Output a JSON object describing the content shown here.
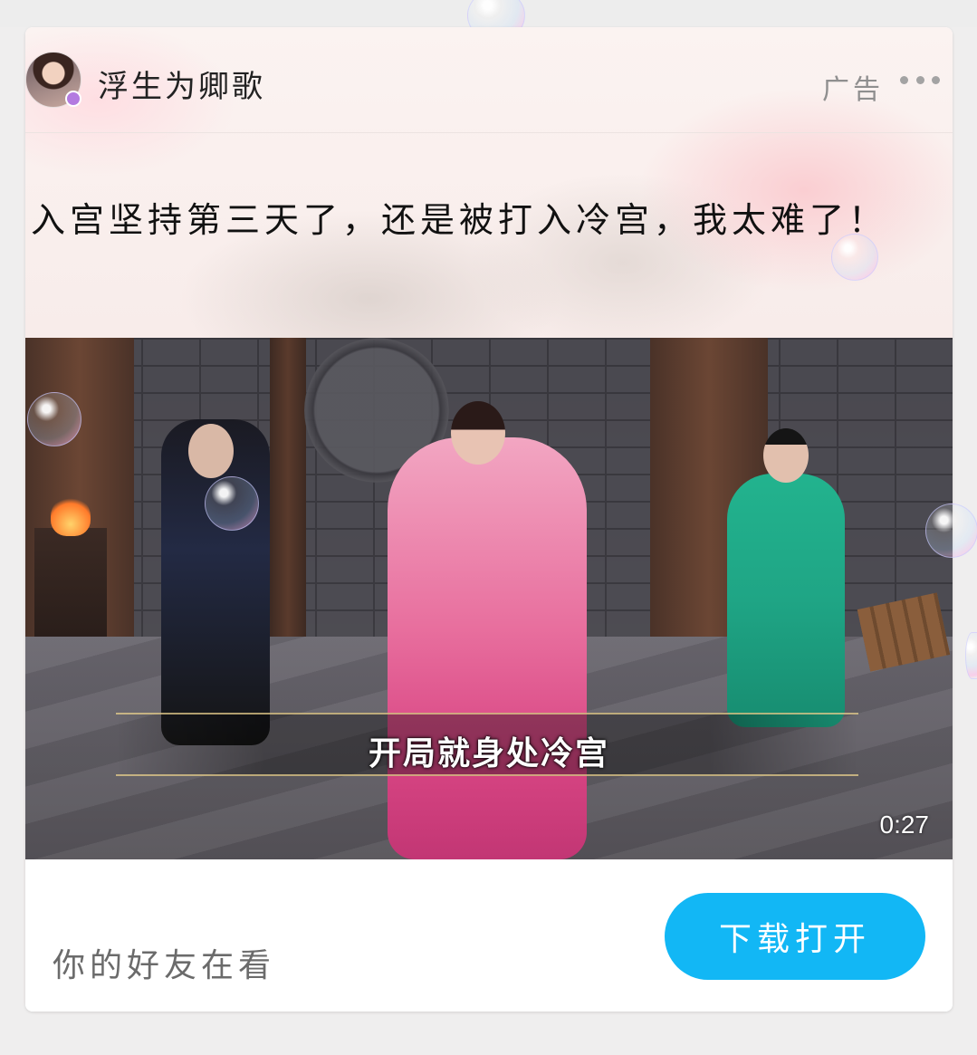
{
  "ad": {
    "advertiser_name": "浮生为卿歌",
    "ad_label": "广告",
    "post_text": "入宫坚持第三天了，还是被打入冷宫，我太难了！",
    "video": {
      "subtitle": "开局就身处冷宫",
      "duration": "0:27"
    },
    "footer": {
      "social_text": "你的好友在看",
      "cta_label": "下载打开"
    }
  },
  "icons": {
    "more": "more-dots-icon"
  },
  "colors": {
    "cta_background": "#12b7f5",
    "cta_text": "#ffffff",
    "ad_label": "#8f8f8f",
    "body_text": "#111111"
  }
}
